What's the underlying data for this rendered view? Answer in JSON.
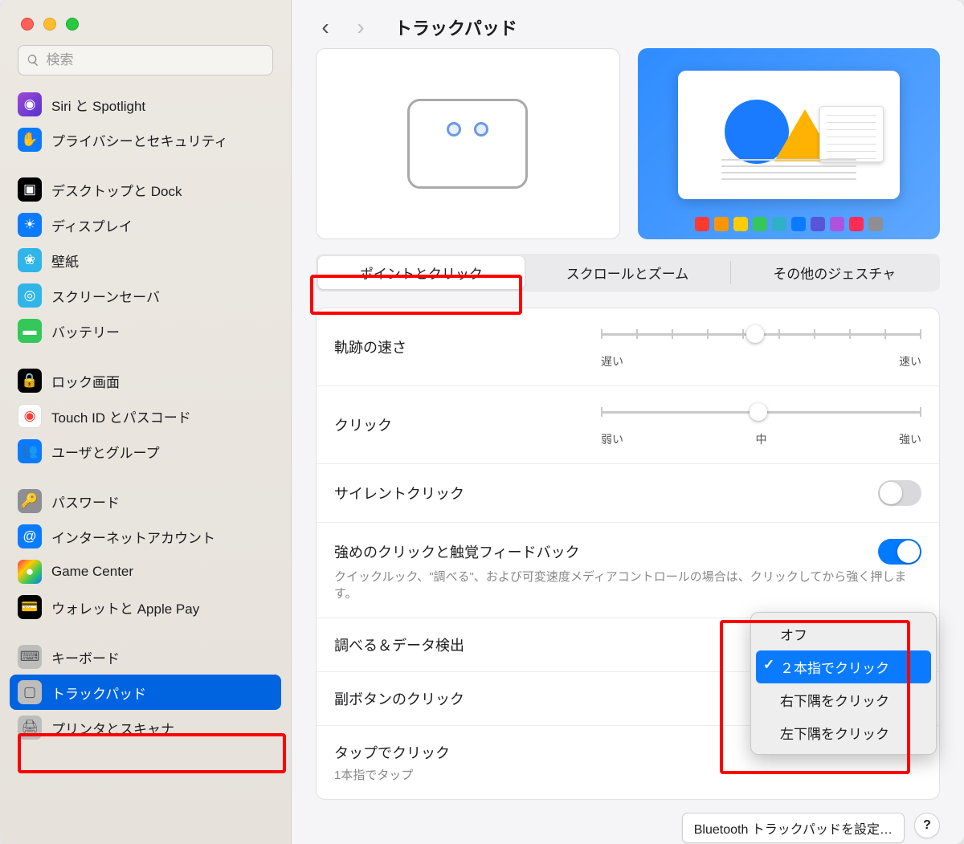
{
  "header": {
    "title": "トラックパッド"
  },
  "search": {
    "placeholder": "検索"
  },
  "sidebar": {
    "groups": [
      [
        {
          "label": "Siri と Spotlight",
          "icon_bg": "linear-gradient(135deg,#9e49d6,#5433d1)",
          "glyph": "◉"
        },
        {
          "label": "プライバシーとセキュリティ",
          "icon_bg": "#0a7bff",
          "glyph": "✋"
        }
      ],
      [
        {
          "label": "デスクトップと Dock",
          "icon_bg": "#000000",
          "glyph": "▣"
        },
        {
          "label": "ディスプレイ",
          "icon_bg": "#0a7bff",
          "glyph": "☀"
        },
        {
          "label": "壁紙",
          "icon_bg": "#2fb5e8",
          "glyph": "❀"
        },
        {
          "label": "スクリーンセーバ",
          "icon_bg": "#2fb5e8",
          "glyph": "◎"
        },
        {
          "label": "バッテリー",
          "icon_bg": "#34c759",
          "glyph": "▬"
        }
      ],
      [
        {
          "label": "ロック画面",
          "icon_bg": "#000000",
          "glyph": "🔒"
        },
        {
          "label": "Touch ID とパスコード",
          "icon_bg": "#ffffff",
          "glyph": "◉",
          "fg": "#ff3b30",
          "border": true
        },
        {
          "label": "ユーザとグループ",
          "icon_bg": "#0a7bff",
          "glyph": "👥"
        }
      ],
      [
        {
          "label": "パスワード",
          "icon_bg": "#8e8e93",
          "glyph": "🔑"
        },
        {
          "label": "インターネットアカウント",
          "icon_bg": "#0a7bff",
          "glyph": "@"
        },
        {
          "label": "Game Center",
          "icon_bg": "linear-gradient(135deg,#ff2d55,#ffcc00,#34c759,#0a7bff)",
          "glyph": "●"
        },
        {
          "label": "ウォレットと Apple Pay",
          "icon_bg": "#000000",
          "glyph": "💳"
        }
      ],
      [
        {
          "label": "キーボード",
          "icon_bg": "#bdbdbd",
          "glyph": "⌨",
          "fg": "#555"
        },
        {
          "label": "トラックパッド",
          "icon_bg": "#bdbdbd",
          "glyph": "▢",
          "fg": "#555",
          "active": true
        },
        {
          "label": "プリンタとスキャナ",
          "icon_bg": "#bdbdbd",
          "glyph": "🖨",
          "fg": "#555"
        }
      ]
    ]
  },
  "tabs": [
    "ポイントとクリック",
    "スクロールとズーム",
    "その他のジェスチャ"
  ],
  "rows": {
    "tracking": {
      "label": "軌跡の速さ",
      "min": "遅い",
      "max": "速い",
      "pos_pct": 48
    },
    "click": {
      "label": "クリック",
      "min": "弱い",
      "mid": "中",
      "max": "強い",
      "pos_pct": 49
    },
    "silent": {
      "label": "サイレントクリック"
    },
    "force": {
      "label": "強めのクリックと触覚フィードバック",
      "sub": "クイックルック、\"調べる\"、および可変速度メディアコントロールの場合は、クリックしてから強く押します。"
    },
    "lookup": {
      "label": "調べる＆データ検出"
    },
    "second": {
      "label": "副ボタンのクリック"
    },
    "tap": {
      "label": "タップでクリック",
      "sub": "1本指でタップ"
    }
  },
  "popup": {
    "items": [
      {
        "label": "オフ"
      },
      {
        "label": "２本指でクリック",
        "selected": true
      },
      {
        "label": "右下隅をクリック"
      },
      {
        "label": "左下隅をクリック"
      }
    ]
  },
  "footer": {
    "setup": "Bluetooth トラックパッドを設定…",
    "help": "?"
  },
  "dock_colors": [
    "#ff3b30",
    "#ff9500",
    "#ffcc00",
    "#34c759",
    "#30b0c7",
    "#0a7bff",
    "#5856d6",
    "#af52de",
    "#ff2d55",
    "#8e8e93"
  ]
}
